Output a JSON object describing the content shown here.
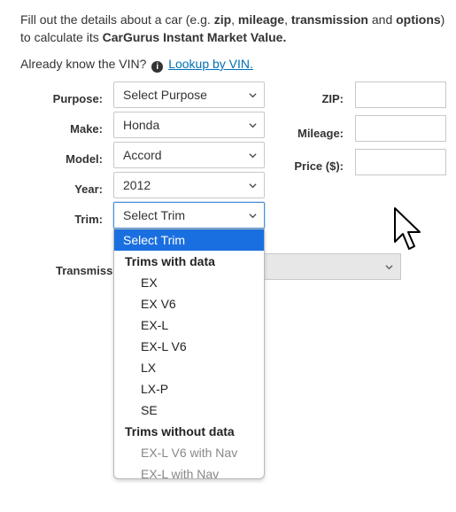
{
  "intro": {
    "t1": "Fill out the details about a car (e.g. ",
    "zip": "zip",
    "c1": ", ",
    "mileage": "mileage",
    "c2": ", ",
    "transmission": "transmission",
    "and": " and ",
    "options": "options",
    "close": ")",
    "t2": "to calculate its ",
    "imv": "CarGurus Instant Market Value.",
    "vin_question": "Already know the VIN?",
    "vin_link": "Lookup by VIN."
  },
  "form": {
    "purpose_label": "Purpose:",
    "purpose_value": "Select Purpose",
    "make_label": "Make:",
    "make_value": "Honda",
    "model_label": "Model:",
    "model_value": "Accord",
    "year_label": "Year:",
    "year_value": "2012",
    "trim_label": "Trim:",
    "trim_value": "Select Trim",
    "transmission_label": "Transmissio",
    "zip_label": "ZIP:",
    "mileage_label": "Mileage:",
    "price_label": "Price ($):"
  },
  "trim_dropdown": {
    "selected": "Select Trim",
    "group_with": "Trims with data",
    "with_data": [
      "EX",
      "EX V6",
      "EX-L",
      "EX-L V6",
      "LX",
      "LX-P",
      "SE"
    ],
    "group_without": "Trims without data",
    "without_data": [
      "EX-L V6 with Nav",
      "EX-L with Nav"
    ]
  },
  "icons": {
    "info": "info-icon",
    "chevron": "chevron-down-icon",
    "cursor": "mouse-pointer-icon"
  },
  "colors": {
    "link": "#0070b8",
    "highlight": "#1a6fe0",
    "disabled_text": "#888888"
  }
}
